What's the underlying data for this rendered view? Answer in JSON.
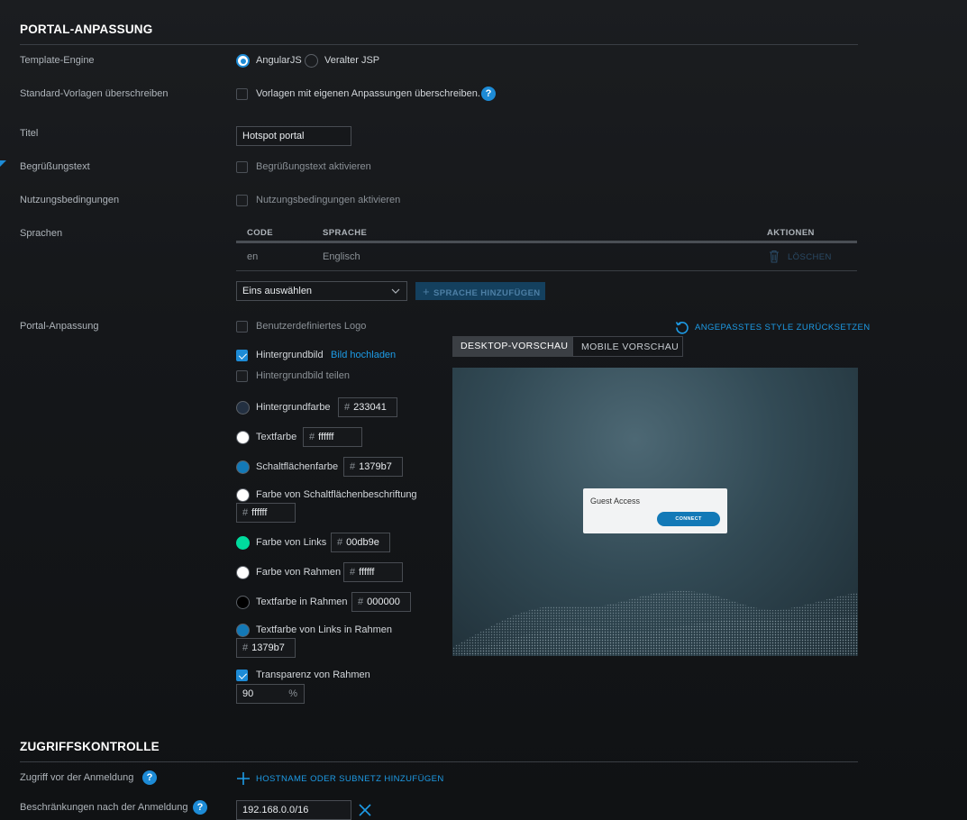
{
  "portal_section": {
    "title": "PORTAL-ANPASSUNG",
    "template_engine": {
      "label": "Template-Engine",
      "options": [
        "AngularJS",
        "Veralter JSP"
      ],
      "selected": "AngularJS"
    },
    "override": {
      "label": "Standard-Vorlagen überschreiben",
      "checkbox_label": "Vorlagen mit eigenen Anpassungen überschreiben.",
      "checked": false
    },
    "title_field": {
      "label": "Titel",
      "value": "Hotspot portal"
    },
    "welcome": {
      "label": "Begrüßungstext",
      "checkbox_label": "Begrüßungstext aktivieren",
      "checked": false
    },
    "terms": {
      "label": "Nutzungsbedingungen",
      "checkbox_label": "Nutzungsbedingungen aktivieren",
      "checked": false
    },
    "languages": {
      "label": "Sprachen",
      "columns": [
        "CODE",
        "SPRACHE",
        "AKTIONEN"
      ],
      "rows": [
        {
          "code": "en",
          "language": "Englisch",
          "action": "LÖSCHEN"
        }
      ],
      "select_value": "Eins auswählen",
      "add_button": "SPRACHE HINZUFÜGEN"
    },
    "customization": {
      "label": "Portal-Anpassung",
      "reset_label": "ANGEPASSTES STYLE ZURÜCKSETZEN",
      "custom_logo": {
        "label": "Benutzerdefiniertes Logo",
        "checked": false
      },
      "bg_image": {
        "label": "Hintergrundbild",
        "link": "Bild hochladen",
        "checked": true
      },
      "bg_tile": {
        "label": "Hintergrundbild teilen",
        "checked": false
      },
      "colors": {
        "background": {
          "label": "Hintergrundfarbe",
          "value": "233041",
          "color": "#233041"
        },
        "text": {
          "label": "Textfarbe",
          "value": "ffffff",
          "color": "#ffffff"
        },
        "button": {
          "label": "Schaltflächenfarbe",
          "value": "1379b7",
          "color": "#1379b7"
        },
        "button_text": {
          "label": "Farbe von Schaltflächenbeschriftung",
          "value": "ffffff",
          "color": "#ffffff"
        },
        "link": {
          "label": "Farbe von Links",
          "value": "00db9e",
          "color": "#00db9e"
        },
        "border": {
          "label": "Farbe von Rahmen",
          "value": "ffffff",
          "color": "#ffffff"
        },
        "box_text": {
          "label": "Textfarbe in Rahmen",
          "value": "000000",
          "color": "#000000"
        },
        "box_link": {
          "label": "Textfarbe von Links in Rahmen",
          "value": "1379b7",
          "color": "#1379b7"
        }
      },
      "transparency": {
        "label": "Transparenz von Rahmen",
        "checked": true,
        "value": "90",
        "unit": "%"
      },
      "tabs": [
        "DESKTOP-VORSCHAU",
        "MOBILE VORSCHAU"
      ],
      "active_tab": "DESKTOP-VORSCHAU",
      "preview": {
        "card_title": "Guest Access",
        "card_button": "CONNECT"
      }
    }
  },
  "access_section": {
    "title": "ZUGRIFFSKONTROLLE",
    "pre_auth": {
      "label": "Zugriff vor der Anmeldung",
      "add_label": "HOSTNAME ODER SUBNETZ HINZUFÜGEN"
    },
    "post_auth": {
      "label": "Beschränkungen nach der Anmeldung",
      "value": "192.168.0.0/16"
    }
  },
  "colors": {
    "accent": "#1d8bd6"
  }
}
